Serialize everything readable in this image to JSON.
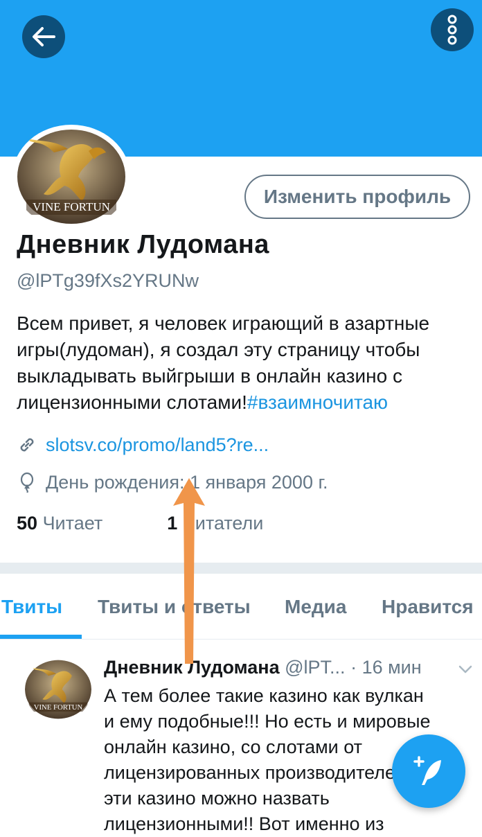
{
  "header": {
    "back_icon": "arrow-left-icon",
    "more_icon": "more-vertical-icon",
    "banner_color": "#1da1f2"
  },
  "profile": {
    "avatar_text": "VINE FORTUN",
    "edit_button": "Изменить профиль",
    "name": "Дневник Лудомана",
    "handle": "@lPTg39fXs2YRUNw",
    "bio_lines": [
      "Всем привет, я человек играющий в азартные",
      "игры(лудоман), я создал эту страницу чтобы",
      "выкладывать выйгрыши в онлайн казино с"
    ],
    "bio_last_text": "лицензионными слотами!",
    "bio_hashtag": "#взаимночитаю",
    "link": "slotsv.co/promo/land5?re...",
    "birthday": "День рождения: 1 января 2000 г.",
    "following_count": "50",
    "following_label": "Читает",
    "followers_count": "1",
    "followers_label": "Читатели"
  },
  "tabs": [
    {
      "label": "Твиты",
      "active": true
    },
    {
      "label": "Твиты и ответы",
      "active": false
    },
    {
      "label": "Медиа",
      "active": false
    },
    {
      "label": "Нравится",
      "active": false
    }
  ],
  "tweet": {
    "name": "Дневник Лудомана",
    "handle": "@lPT...",
    "dot": "·",
    "time": "16 мин",
    "lines": [
      "А тем более такие казино как вулкан",
      "и ему подобные!!! Но есть и мировые",
      "онлайн казино, со слотами от",
      "лицензированных производителей!!!",
      "эти казино можно назвать",
      "лицензионными!! Вот именно из"
    ]
  },
  "fab": {
    "icon": "compose-tweet-icon"
  },
  "colors": {
    "accent": "#1da1f2",
    "annotation_arrow": "#f0954a"
  }
}
